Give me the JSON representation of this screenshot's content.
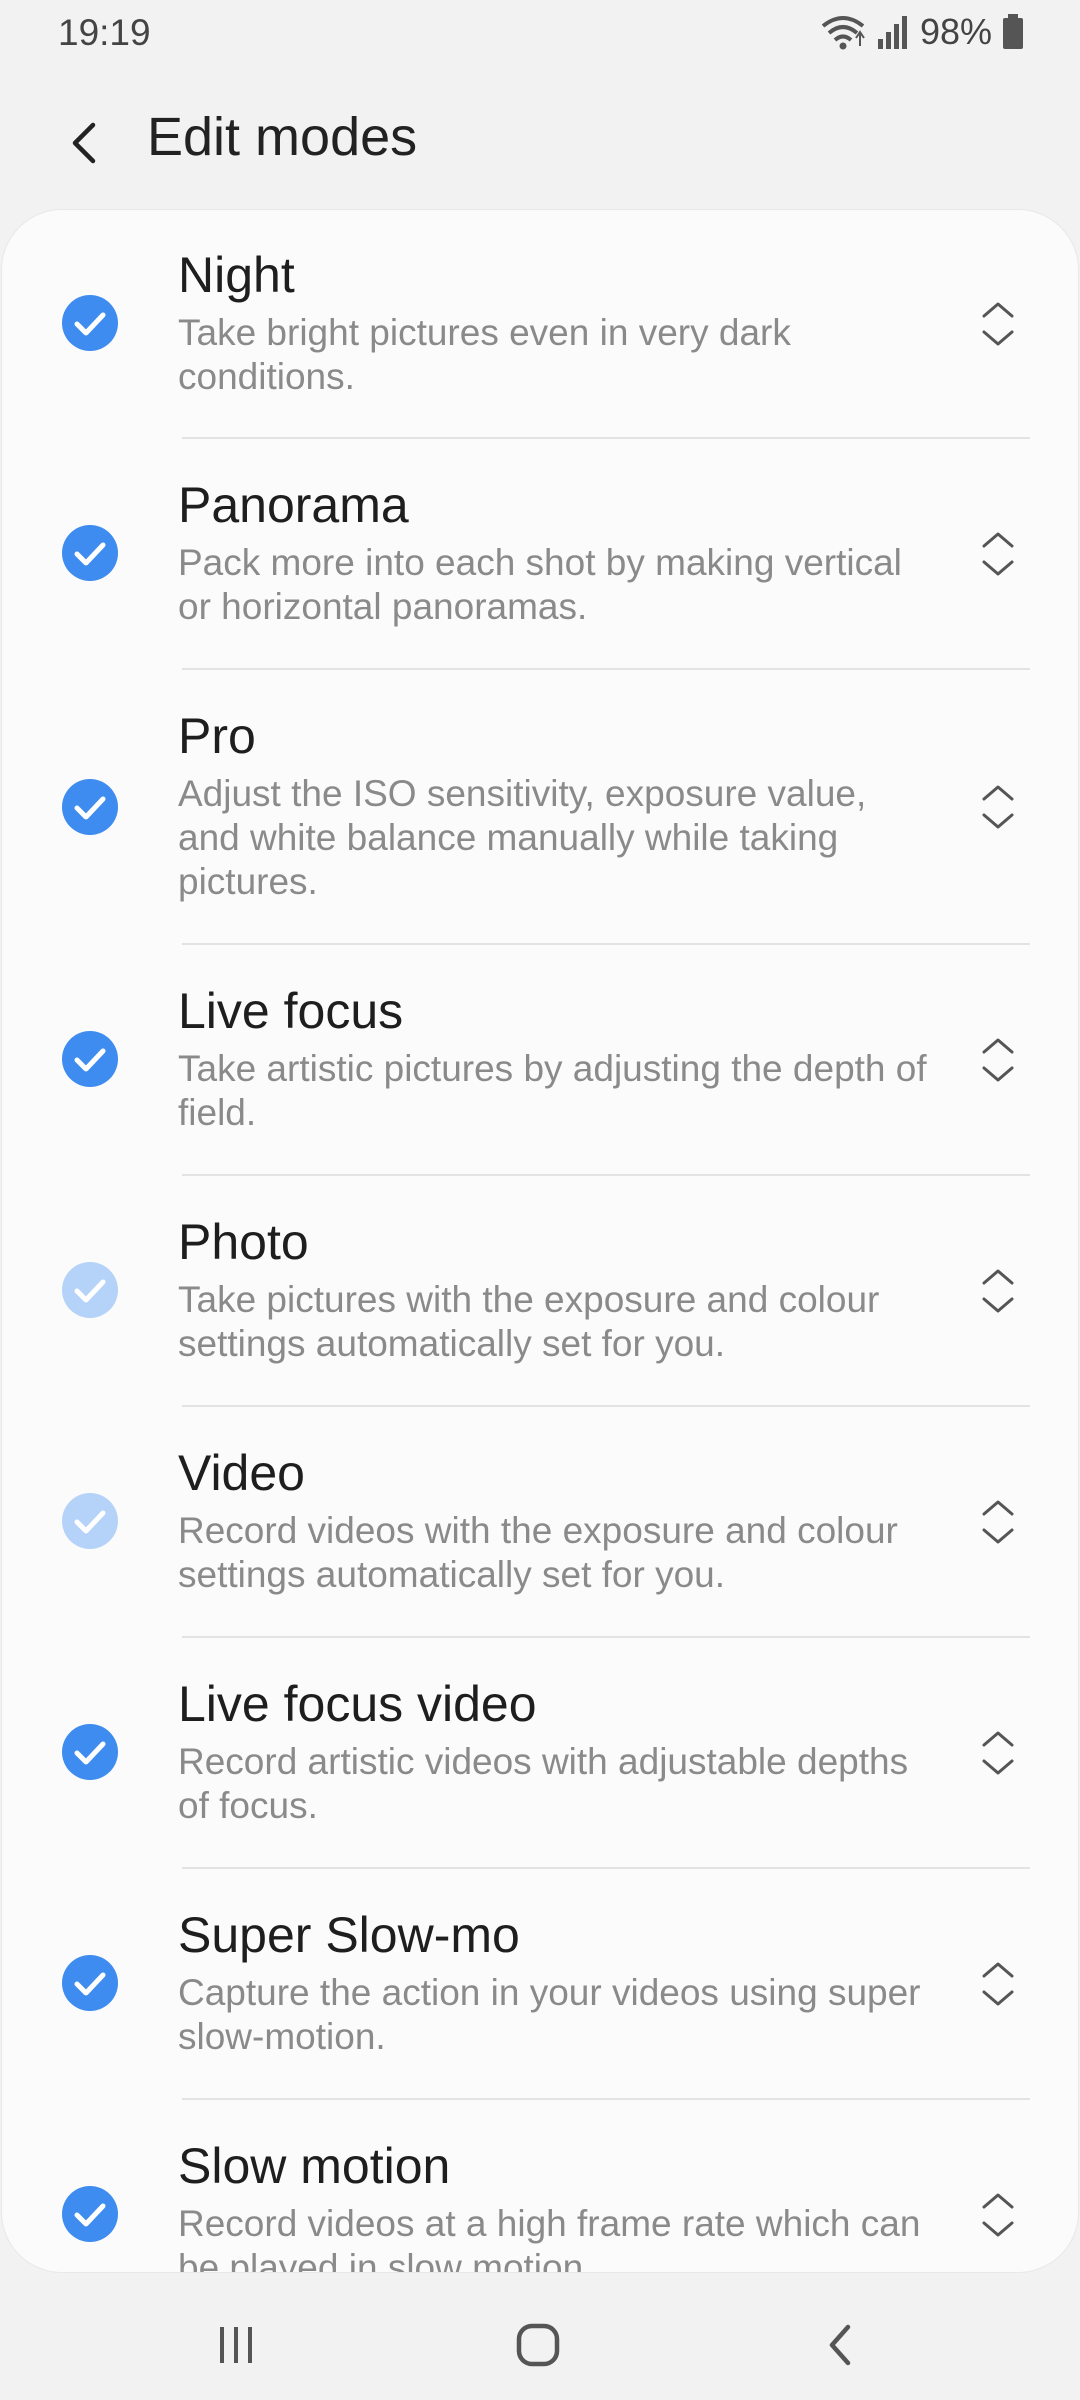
{
  "status_bar": {
    "time": "19:19",
    "battery": "98%",
    "icons": [
      "wifi-icon",
      "signal-icon",
      "battery-icon"
    ]
  },
  "header": {
    "back_icon": "chevron-left-icon",
    "title": "Edit modes"
  },
  "colors": {
    "check_active": "#3e8cf0",
    "check_disabled": "#b5d3f8",
    "background": "#f2f2f2",
    "card": "#fbfbfb"
  },
  "modes": [
    {
      "title": "Night",
      "description": "Take bright pictures even in very dark conditions.",
      "checked": true,
      "enabled": true
    },
    {
      "title": "Panorama",
      "description": "Pack more into each shot by making vertical or horizontal panoramas.",
      "checked": true,
      "enabled": true
    },
    {
      "title": "Pro",
      "description": "Adjust the ISO sensitivity, exposure value, and white balance manually while taking pictures.",
      "checked": true,
      "enabled": true
    },
    {
      "title": "Live focus",
      "description": "Take artistic pictures by adjusting the depth of field.",
      "checked": true,
      "enabled": true
    },
    {
      "title": "Photo",
      "description": "Take pictures with the exposure and colour settings automatically set for you.",
      "checked": true,
      "enabled": false
    },
    {
      "title": "Video",
      "description": "Record videos with the exposure and colour settings automatically set for you.",
      "checked": true,
      "enabled": false
    },
    {
      "title": "Live focus video",
      "description": "Record artistic videos with adjustable depths of focus.",
      "checked": true,
      "enabled": true
    },
    {
      "title": "Super Slow-mo",
      "description": "Capture the action in your videos using super slow-motion.",
      "checked": true,
      "enabled": true
    },
    {
      "title": "Slow motion",
      "description": "Record videos at a high frame rate which can be played in slow motion.",
      "checked": true,
      "enabled": true
    }
  ],
  "nav_bar": {
    "icons": [
      "recent-apps-icon",
      "home-icon",
      "back-icon"
    ]
  }
}
